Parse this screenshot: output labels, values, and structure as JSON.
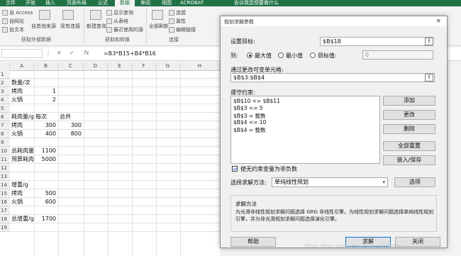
{
  "ribbon": {
    "tabs": [
      "文件",
      "开始",
      "插入",
      "页面布局",
      "公式",
      "数据",
      "审阅",
      "视图",
      "ACROBAT",
      "告诉我您想要做什么"
    ],
    "active_tab": "数据",
    "items": [
      "自 Access",
      "自网站",
      "自文本",
      "自其他来源",
      "现有连接",
      "新建查询",
      "显示查询",
      "从表格",
      "最近使用的源",
      "全部刷新",
      "连接",
      "属性",
      "编辑链接"
    ],
    "groups": [
      "获取外部数据",
      "获取和转换",
      "连接"
    ]
  },
  "formula_bar": {
    "cancel_icon": "cancel-icon",
    "enter_icon": "check-icon",
    "fx_label": "fx",
    "formula": "=B3*B15+B4*B16"
  },
  "grid": {
    "columns": [
      "A",
      "B",
      "C",
      "D",
      "E",
      "F",
      "G",
      "H"
    ],
    "rows": [
      "1",
      "2",
      "3",
      "4",
      "5",
      "6",
      "7",
      "8",
      "9",
      "10",
      "11",
      "12",
      "13",
      "14",
      "15",
      "16",
      "17",
      "18",
      "19"
    ],
    "cells": [
      {
        "id": "A2",
        "text": "数量/次",
        "numeric": false
      },
      {
        "id": "A3",
        "text": "烤肉",
        "numeric": false
      },
      {
        "id": "B3",
        "text": "1",
        "numeric": true
      },
      {
        "id": "A4",
        "text": "火锅",
        "numeric": false
      },
      {
        "id": "B4",
        "text": "2",
        "numeric": true
      },
      {
        "id": "A6",
        "text": "耗肉量/g",
        "numeric": false
      },
      {
        "id": "B6",
        "text": "每次",
        "numeric": false
      },
      {
        "id": "C6",
        "text": "总共",
        "numeric": false
      },
      {
        "id": "A7",
        "text": "烤肉",
        "numeric": false
      },
      {
        "id": "B7",
        "text": "300",
        "numeric": true
      },
      {
        "id": "C7",
        "text": "300",
        "numeric": true
      },
      {
        "id": "A8",
        "text": "火锅",
        "numeric": false
      },
      {
        "id": "B8",
        "text": "400",
        "numeric": true
      },
      {
        "id": "C8",
        "text": "800",
        "numeric": true
      },
      {
        "id": "A10",
        "text": "总耗肉量",
        "numeric": false
      },
      {
        "id": "B10",
        "text": "1100",
        "numeric": true
      },
      {
        "id": "A11",
        "text": "预算耗肉",
        "numeric": false
      },
      {
        "id": "B11",
        "text": "5000",
        "numeric": true
      },
      {
        "id": "A14",
        "text": "增重/g",
        "numeric": false
      },
      {
        "id": "A15",
        "text": "烤肉",
        "numeric": false
      },
      {
        "id": "B15",
        "text": "500",
        "numeric": true
      },
      {
        "id": "A16",
        "text": "火锅",
        "numeric": false
      },
      {
        "id": "B16",
        "text": "600",
        "numeric": true
      },
      {
        "id": "A18",
        "text": "总增重/g",
        "numeric": false
      },
      {
        "id": "B18",
        "text": "1700",
        "numeric": true
      }
    ]
  },
  "dialog": {
    "title": "规划求解参数",
    "close": "✕",
    "objective_label": "设置目标:",
    "objective_value": "$B$18",
    "to_label": "到:",
    "opt_max": "最大值",
    "opt_min": "最小值",
    "opt_value": "目标值:",
    "target_value": "0",
    "changing_label": "通过更改可变单元格:",
    "changing_value": "$B$3:$B$4",
    "constraints_label": "遵守约束:",
    "constraints": [
      "$B$10 <= $B$11",
      "$B$3 <= 5",
      "$B$3 = 整数",
      "$B$4 <= 10",
      "$B$4 = 整数"
    ],
    "buttons": {
      "add": "添加",
      "change": "更改",
      "delete": "删除",
      "reset": "全部重置",
      "load_save": "装入/保存"
    },
    "nonneg_label": "使无约束变量为非负数",
    "method_label": "选择求解方法:",
    "method_value": "单纯线性规划",
    "options_button": "选项",
    "desc_heading": "求解方法",
    "desc_text": "为光滑非线性规划求解问题选择 GRG 非线性引擎。为线性规划求解问题选择单纯线性规划引擎，并为非光滑规划求解问题选择演化引擎。",
    "help_button": "帮助",
    "solve_button": "求解",
    "close_button": "关闭"
  },
  "watermark": "https://blog.csdn.net/weixin_39056890"
}
